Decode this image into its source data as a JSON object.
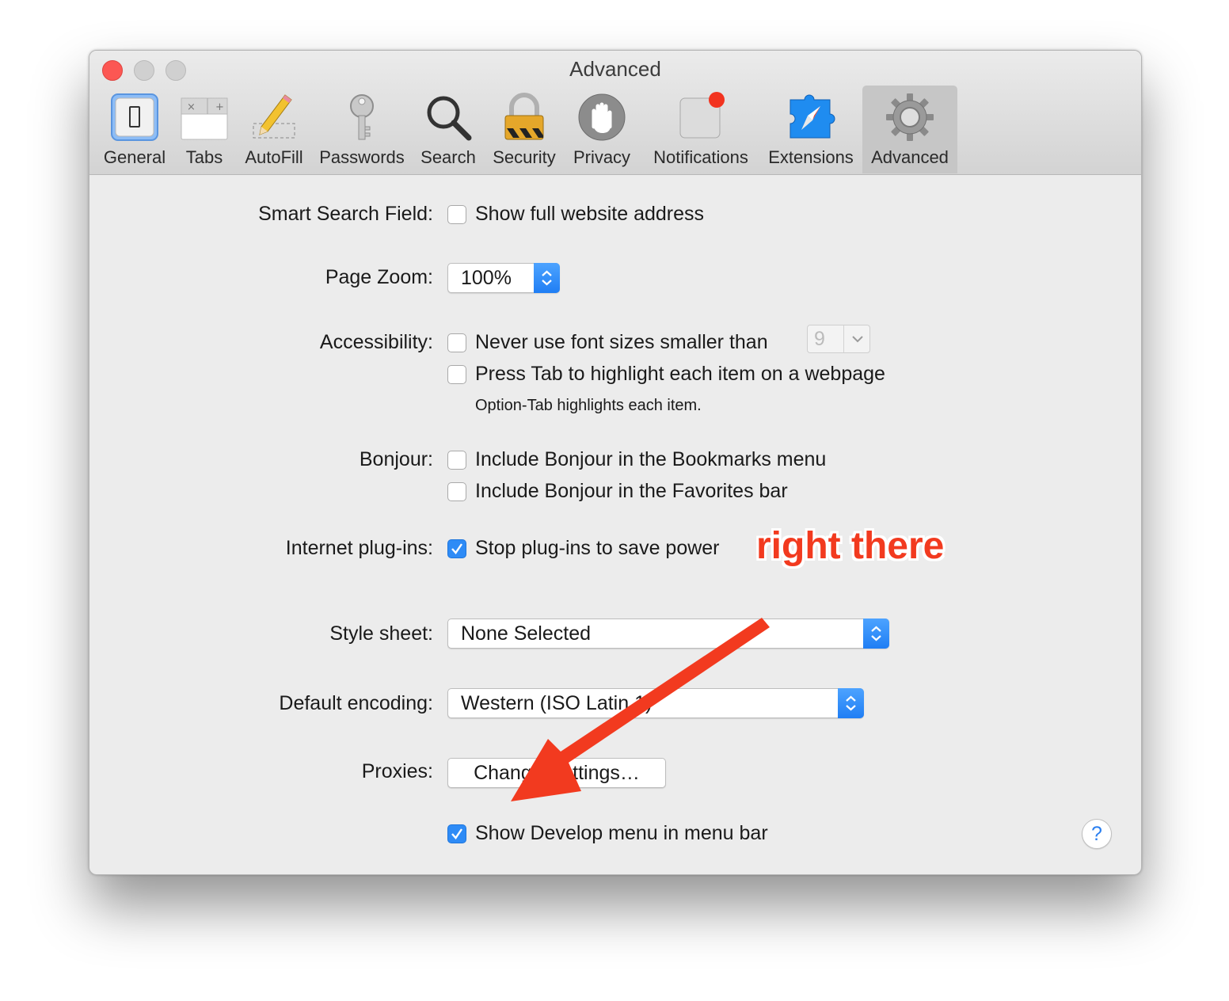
{
  "window": {
    "title": "Advanced"
  },
  "toolbar": {
    "items": [
      {
        "label": "General",
        "icon": "general-icon"
      },
      {
        "label": "Tabs",
        "icon": "tabs-icon"
      },
      {
        "label": "AutoFill",
        "icon": "pencil-icon"
      },
      {
        "label": "Passwords",
        "icon": "key-icon"
      },
      {
        "label": "Search",
        "icon": "magnifier-icon"
      },
      {
        "label": "Security",
        "icon": "lock-icon"
      },
      {
        "label": "Privacy",
        "icon": "hand-icon"
      },
      {
        "label": "Notifications",
        "icon": "notifications-icon"
      },
      {
        "label": "Extensions",
        "icon": "puzzle-compass-icon"
      },
      {
        "label": "Advanced",
        "icon": "gear-icon",
        "selected": true
      }
    ]
  },
  "settings": {
    "smart_search": {
      "label": "Smart Search Field:",
      "option": "Show full website address",
      "checked": false
    },
    "page_zoom": {
      "label": "Page Zoom:",
      "value": "100%"
    },
    "accessibility": {
      "label": "Accessibility:",
      "option1": "Never use font sizes smaller than",
      "option1_checked": false,
      "font_size": "9",
      "option2": "Press Tab to highlight each item on a webpage",
      "option2_checked": false,
      "note": "Option-Tab highlights each item."
    },
    "bonjour": {
      "label": "Bonjour:",
      "option1": "Include Bonjour in the Bookmarks menu",
      "option1_checked": false,
      "option2": "Include Bonjour in the Favorites bar",
      "option2_checked": false
    },
    "plugins": {
      "label": "Internet plug-ins:",
      "option": "Stop plug-ins to save power",
      "checked": true
    },
    "style_sheet": {
      "label": "Style sheet:",
      "value": "None Selected"
    },
    "encoding": {
      "label": "Default encoding:",
      "value": "Western (ISO Latin 1)"
    },
    "proxies": {
      "label": "Proxies:",
      "button": "Change Settings…"
    },
    "develop": {
      "option": "Show Develop menu in menu bar",
      "checked": true
    },
    "help": {
      "label": "?"
    }
  },
  "annotation": {
    "text": "right there",
    "color": "#f23a1f"
  },
  "colors": {
    "accent": "#2e8bf6",
    "close": "#fc5753"
  }
}
